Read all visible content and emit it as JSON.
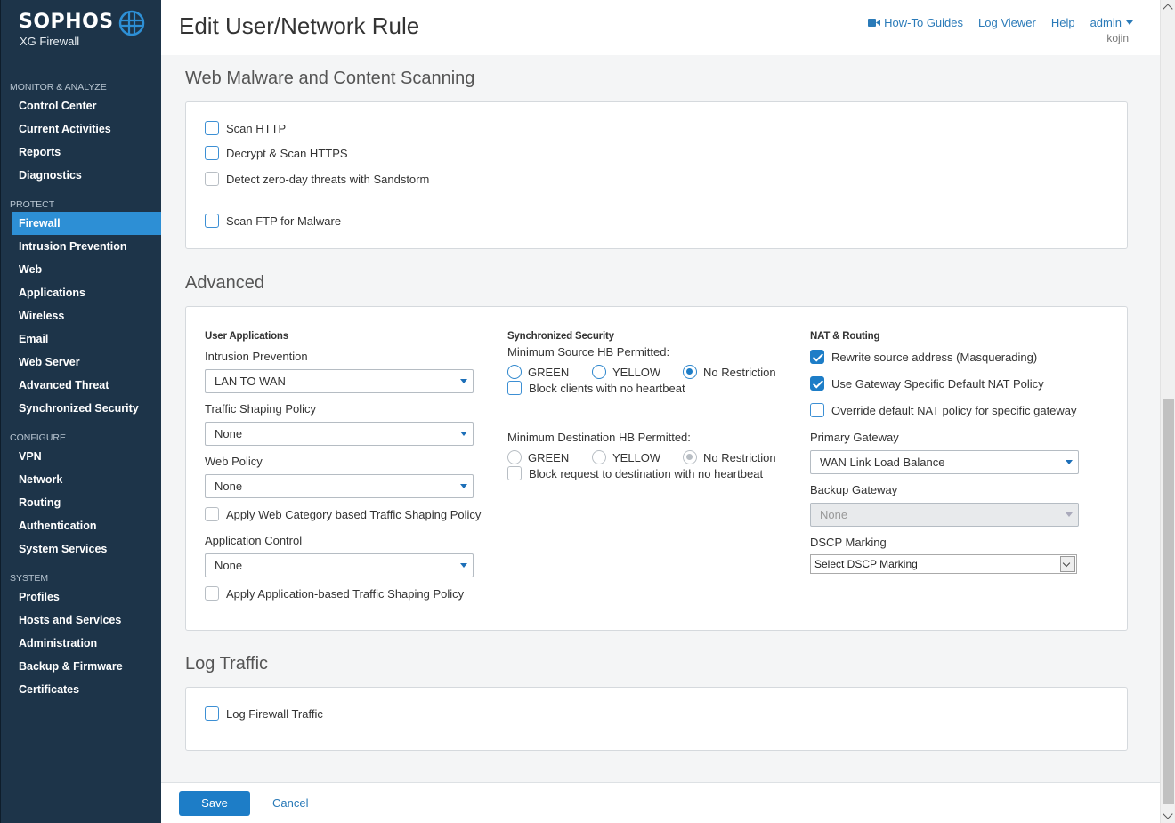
{
  "brand": {
    "name": "SOPHOS",
    "product": "XG Firewall"
  },
  "sidebar": {
    "sections": [
      {
        "title": "MONITOR & ANALYZE",
        "items": [
          "Control Center",
          "Current Activities",
          "Reports",
          "Diagnostics"
        ]
      },
      {
        "title": "PROTECT",
        "items": [
          "Firewall",
          "Intrusion Prevention",
          "Web",
          "Applications",
          "Wireless",
          "Email",
          "Web Server",
          "Advanced Threat",
          "Synchronized Security"
        ]
      },
      {
        "title": "CONFIGURE",
        "items": [
          "VPN",
          "Network",
          "Routing",
          "Authentication",
          "System Services"
        ]
      },
      {
        "title": "SYSTEM",
        "items": [
          "Profiles",
          "Hosts and Services",
          "Administration",
          "Backup & Firmware",
          "Certificates"
        ]
      }
    ],
    "active_item": "Firewall"
  },
  "header": {
    "title": "Edit User/Network Rule",
    "links": {
      "howto": "How-To Guides",
      "logviewer": "Log Viewer",
      "help": "Help",
      "user": "admin"
    },
    "user_sub": "kojin"
  },
  "malware": {
    "title": "Web Malware and Content Scanning",
    "scan_http": "Scan HTTP",
    "decrypt_https": "Decrypt & Scan HTTPS",
    "sandstorm": "Detect zero-day threats with Sandstorm",
    "scan_ftp": "Scan FTP for Malware"
  },
  "advanced": {
    "title": "Advanced",
    "user_apps": {
      "heading": "User Applications",
      "ips_label": "Intrusion Prevention",
      "ips_value": "LAN TO WAN",
      "shaping_label": "Traffic Shaping Policy",
      "shaping_value": "None",
      "web_label": "Web Policy",
      "web_value": "None",
      "web_cat_shaping": "Apply Web Category based Traffic Shaping Policy",
      "app_label": "Application Control",
      "app_value": "None",
      "app_shaping": "Apply Application-based Traffic Shaping Policy"
    },
    "sync": {
      "heading": "Synchronized Security",
      "min_source": "Minimum Source HB Permitted:",
      "green": "GREEN",
      "yellow": "YELLOW",
      "no_restriction": "No Restriction",
      "block_clients": "Block clients with no heartbeat",
      "min_dest": "Minimum Destination HB Permitted:",
      "block_dest": "Block request to destination with no heartbeat"
    },
    "nat": {
      "heading": "NAT & Routing",
      "masq": "Rewrite source address (Masquerading)",
      "gw_nat": "Use Gateway Specific Default NAT Policy",
      "override": "Override default NAT policy for specific gateway",
      "primary_label": "Primary Gateway",
      "primary_value": "WAN Link Load Balance",
      "backup_label": "Backup Gateway",
      "backup_value": "None",
      "dscp_label": "DSCP Marking",
      "dscp_value": "Select DSCP Marking"
    }
  },
  "log": {
    "title": "Log Traffic",
    "log_fw": "Log Firewall Traffic"
  },
  "footer": {
    "save": "Save",
    "cancel": "Cancel"
  },
  "colors": {
    "sidebar": "#1d3449",
    "accent": "#1d7dc7",
    "link": "#2a7ab8"
  }
}
